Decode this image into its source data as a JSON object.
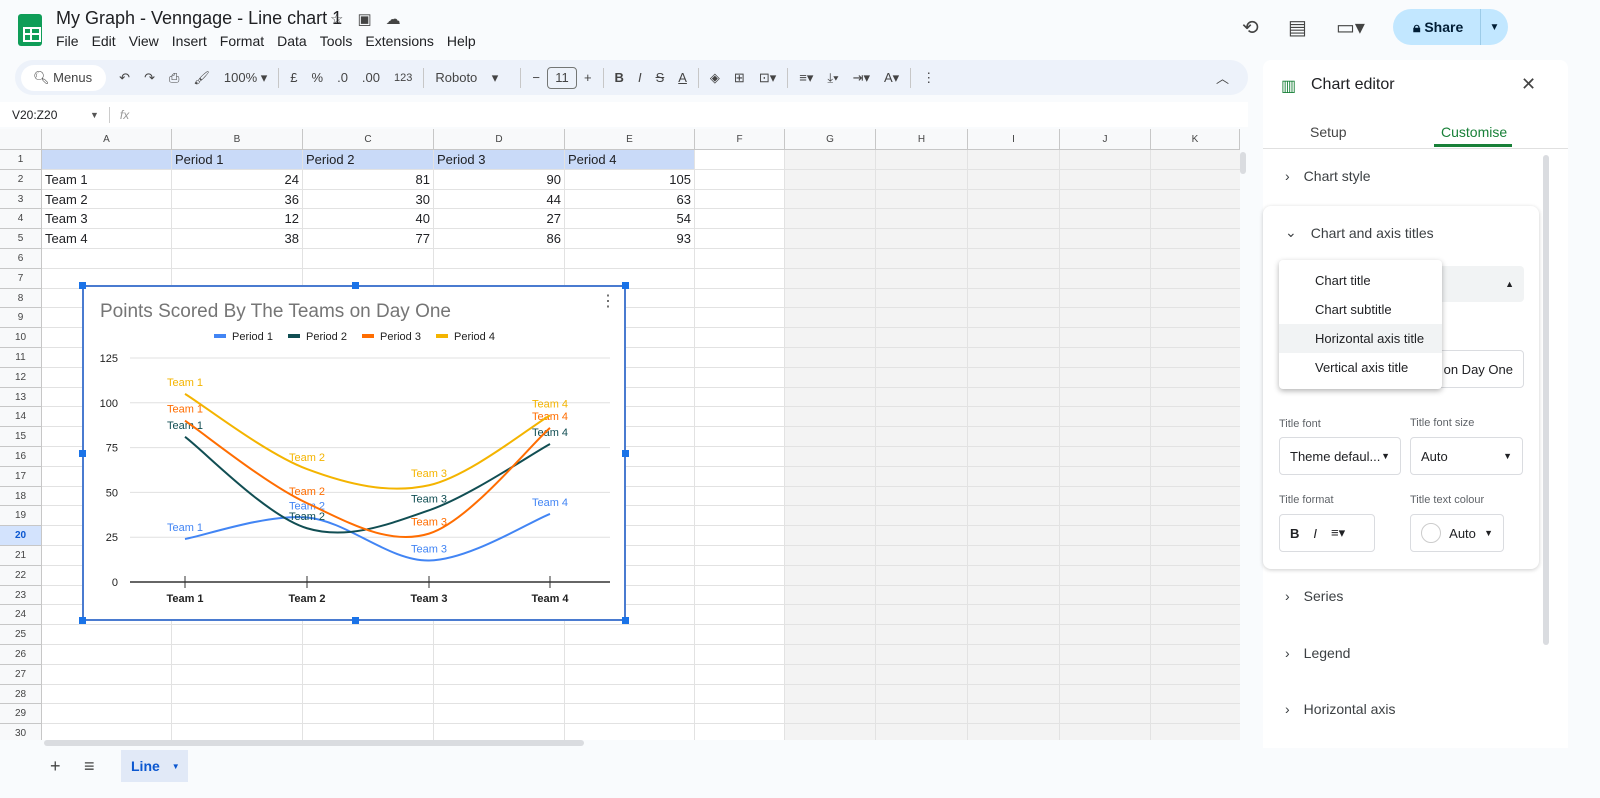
{
  "app": {
    "title": "My Graph - Venngage - Line chart 1",
    "menu": [
      "File",
      "Edit",
      "View",
      "Insert",
      "Format",
      "Data",
      "Tools",
      "Extensions",
      "Help"
    ],
    "share_label": "Share"
  },
  "toolbar": {
    "menus": "Menus",
    "zoom": "100%",
    "currency": "£",
    "percent": "%",
    "dec_decrease": ".0",
    "dec_increase": ".00",
    "number_format": "123",
    "font": "Roboto",
    "font_size": "11"
  },
  "formula_bar": {
    "name_box": "V20:Z20",
    "fx": "fx",
    "value": ""
  },
  "sheet": {
    "columns": [
      "A",
      "B",
      "C",
      "D",
      "E",
      "F",
      "G",
      "H",
      "I",
      "J",
      "K"
    ],
    "rows": [
      [
        "",
        "Period 1",
        "Period 2",
        "Period 3",
        "Period 4"
      ],
      [
        "Team 1",
        "24",
        "81",
        "90",
        "105"
      ],
      [
        "Team 2",
        "36",
        "30",
        "44",
        "63"
      ],
      [
        "Team 3",
        "12",
        "40",
        "27",
        "54"
      ],
      [
        "Team 4",
        "38",
        "77",
        "86",
        "93"
      ]
    ],
    "row_count": 31,
    "selected_row": 20
  },
  "chart_data": {
    "type": "line",
    "title": "Points Scored By The Teams on Day One",
    "smooth": true,
    "categories": [
      "Team 1",
      "Team 2",
      "Team 3",
      "Team 4"
    ],
    "ylim": [
      0,
      125
    ],
    "yticks": [
      "0",
      "25",
      "50",
      "75",
      "100",
      "125"
    ],
    "grid": true,
    "legend": "top",
    "series": [
      {
        "name": "Period 1",
        "color": "#4285f4",
        "values": [
          24,
          36,
          12,
          38
        ]
      },
      {
        "name": "Period 2",
        "color": "#114e53",
        "values": [
          81,
          30,
          40,
          77
        ]
      },
      {
        "name": "Period 3",
        "color": "#ff6d01",
        "values": [
          90,
          44,
          27,
          86
        ]
      },
      {
        "name": "Period 4",
        "color": "#f4b400",
        "values": [
          105,
          63,
          54,
          93
        ]
      }
    ],
    "data_labels": "category"
  },
  "editor": {
    "title": "Chart editor",
    "tabs": [
      "Setup",
      "Customise"
    ],
    "active_tab": "Customise",
    "sections": {
      "chart_style": "Chart style",
      "titles": "Chart and axis titles",
      "series": "Series",
      "legend": "Legend",
      "haxis": "Horizontal axis"
    },
    "dropdown_options": [
      "Chart title",
      "Chart subtitle",
      "Horizontal axis title",
      "Vertical axis title"
    ],
    "highlighted_option": "Horizontal axis title",
    "title_text_partial": "s on Day One",
    "title_font_label": "Title font",
    "title_font": "Theme defaul...",
    "title_size_label": "Title font size",
    "title_size": "Auto",
    "title_format_label": "Title format",
    "title_colour_label": "Title text colour",
    "title_colour": "Auto"
  },
  "sheet_tab": {
    "name": "Line"
  },
  "colors": {
    "accent": "#188038",
    "share_bg": "#c2e7ff",
    "selection": "#1a73e8"
  }
}
